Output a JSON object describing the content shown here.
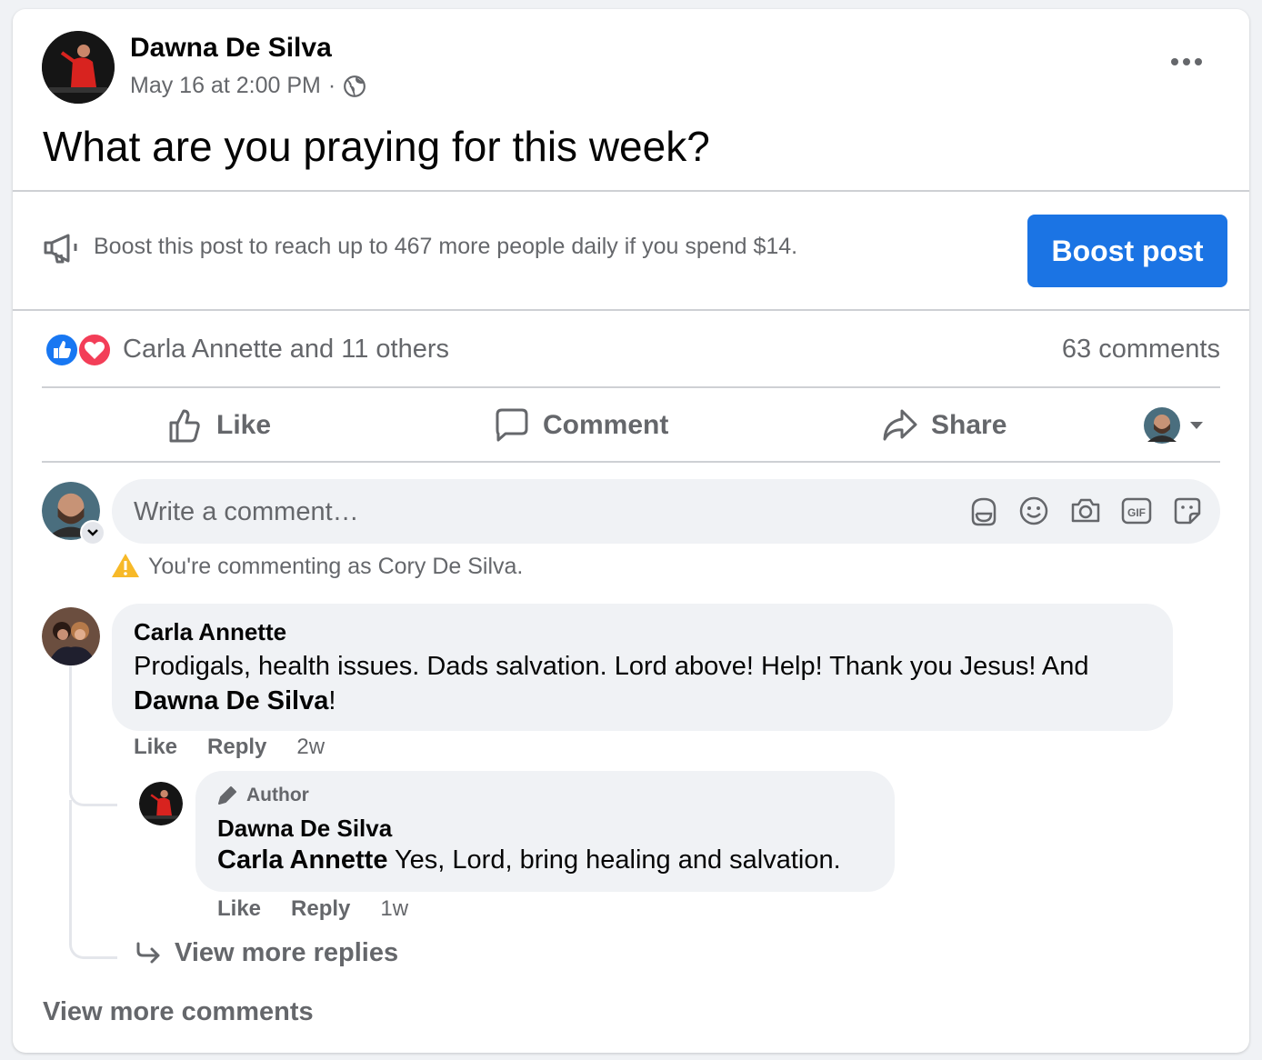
{
  "post": {
    "author": "Dawna De Silva",
    "timestamp": "May 16 at 2:00 PM",
    "separator": "·",
    "privacy_icon": "globe-icon",
    "text": "What are you praying for this week?",
    "more_icon": "more-dots-icon"
  },
  "boost": {
    "icon": "megaphone-icon",
    "message": "Boost this post to reach up to 467 more people daily if you spend $14.",
    "button_label": "Boost post",
    "button_color": "#1b74e4"
  },
  "reactions": {
    "icons": [
      "like-icon",
      "love-icon"
    ],
    "summary": "Carla Annette and 11 others",
    "comments_count": "63 comments"
  },
  "actions": {
    "like": "Like",
    "comment": "Comment",
    "share": "Share"
  },
  "composer": {
    "placeholder": "Write a comment…",
    "icons": [
      "avatar-sticker-icon",
      "emoji-icon",
      "camera-icon",
      "gif-icon",
      "sticker-icon"
    ],
    "warning": "You're commenting as Cory De Silva.",
    "warning_color": "#f7b928"
  },
  "comments": [
    {
      "author": "Carla Annette",
      "text": "Prodigals, health issues. Dads salvation. Lord above! Help! Thank you Jesus! And",
      "mention": "Dawna De Silva",
      "mention_suffix": "!",
      "like": "Like",
      "reply": "Reply",
      "time": "2w",
      "replies": [
        {
          "badge": "Author",
          "author": "Dawna De Silva",
          "mention": "Carla Annette",
          "text": " Yes, Lord, bring healing and salvation.",
          "like": "Like",
          "reply": "Reply",
          "time": "1w"
        }
      ],
      "view_more_replies": "View more replies"
    }
  ],
  "view_more_comments": "View more comments"
}
